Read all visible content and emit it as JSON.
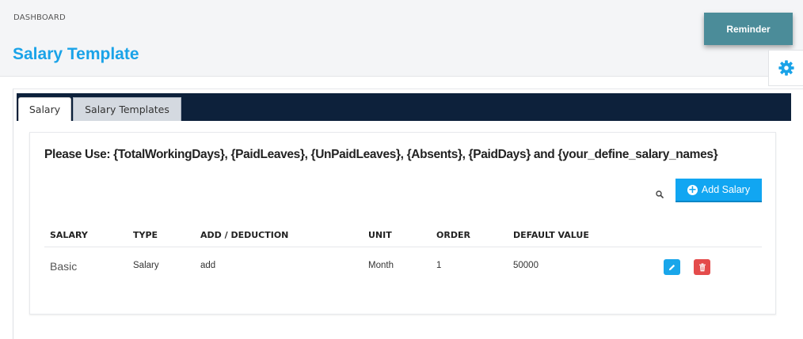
{
  "breadcrumb": "DASHBOARD",
  "page_title": "Salary Template",
  "reminder_label": "Reminder",
  "tabs": [
    {
      "label": "Salary"
    },
    {
      "label": "Salary Templates"
    }
  ],
  "note": "Please Use: {TotalWorkingDays}, {PaidLeaves}, {UnPaidLeaves}, {Absents}, {PaidDays} and {your_define_salary_names}",
  "add_salary_label": "Add Salary",
  "table": {
    "headers": [
      "SALARY",
      "TYPE",
      "ADD / DEDUCTION",
      "UNIT",
      "ORDER",
      "DEFAULT VALUE"
    ],
    "rows": [
      {
        "salary": "Basic",
        "type": "Salary",
        "add_deduction": "add",
        "unit": "Month",
        "order": "1",
        "default_value": "50000"
      }
    ]
  },
  "icons": {
    "settings": "gear-icon",
    "search": "search-icon",
    "add": "plus-circle-icon",
    "edit": "pencil-icon",
    "delete": "trash-icon"
  },
  "colors": {
    "title": "#1aa3e8",
    "reminder": "#4b8c99",
    "tabbar": "#0d213b",
    "add_button": "#11a6f2",
    "edit_button": "#19a6ea",
    "delete_button": "#e44b4b",
    "gear": "#1aa3e8"
  }
}
